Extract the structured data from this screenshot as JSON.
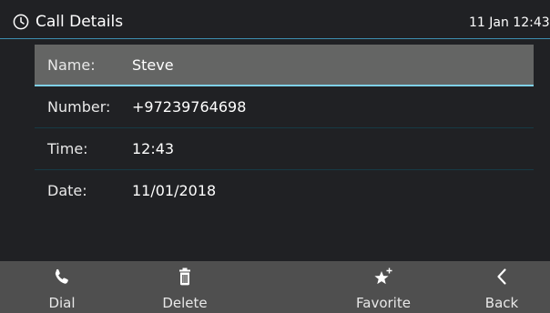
{
  "header": {
    "title": "Call Details",
    "datetime": "11 Jan 12:43",
    "icon": "clock-icon"
  },
  "details": {
    "rows": [
      {
        "label": "Name:",
        "value": "Steve",
        "selected": true
      },
      {
        "label": "Number:",
        "value": "+97239764698",
        "selected": false
      },
      {
        "label": "Time:",
        "value": "12:43",
        "selected": false
      },
      {
        "label": "Date:",
        "value": "11/01/2018",
        "selected": false
      }
    ]
  },
  "softkeys": {
    "dial": {
      "label": "Dial",
      "icon": "phone-icon"
    },
    "delete": {
      "label": "Delete",
      "icon": "trash-icon"
    },
    "favorite": {
      "label": "Favorite",
      "icon": "star-plus-icon"
    },
    "back": {
      "label": "Back",
      "icon": "chevron-left-icon"
    }
  },
  "colors": {
    "background": "#202124",
    "selected_row": "#646564",
    "accent": "#3e8fb0",
    "softkey_bar": "#4f4f4f"
  }
}
